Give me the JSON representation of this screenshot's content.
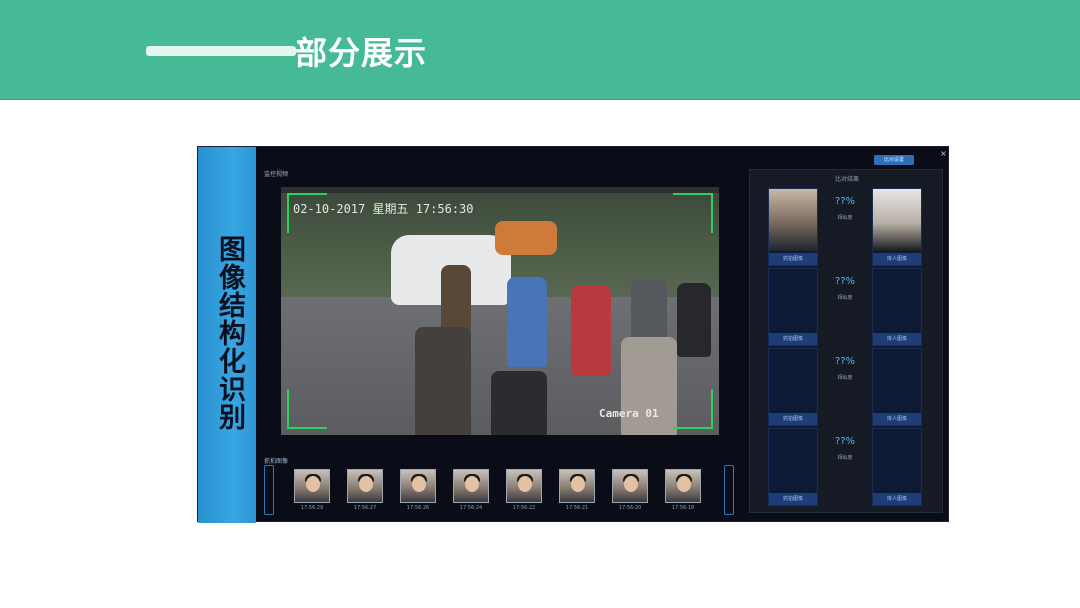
{
  "header": {
    "title": "部分展示"
  },
  "side_band": {
    "text": "图像结构化识别"
  },
  "video_panel": {
    "label": "监控视频",
    "timestamp": "02-10-2017 星期五 17:56:30",
    "camera": "Camera 01"
  },
  "snapshots": {
    "label": "抓拍图像",
    "items": [
      {
        "caption": "17:56:29"
      },
      {
        "caption": "17:56:27"
      },
      {
        "caption": "17:56:26"
      },
      {
        "caption": "17:56:24"
      },
      {
        "caption": "17:56:22"
      },
      {
        "caption": "17:56:21"
      },
      {
        "caption": "17:56:20"
      },
      {
        "caption": "17:56:18"
      }
    ]
  },
  "compare_panel": {
    "title": "比对结果",
    "top_button": "比对设置",
    "close": "×",
    "rows": [
      {
        "left_label": "抓拍图像",
        "pct": "??%",
        "sim_label": "相似度",
        "right_label": "库人图像"
      },
      {
        "left_label": "抓拍图像",
        "pct": "??%",
        "sim_label": "相似度",
        "right_label": "库人图像"
      },
      {
        "left_label": "抓拍图像",
        "pct": "??%",
        "sim_label": "相似度",
        "right_label": "库人图像"
      },
      {
        "left_label": "抓拍图像",
        "pct": "??%",
        "sim_label": "相似度",
        "right_label": "库人图像"
      }
    ]
  },
  "colors": {
    "header": "#46b996",
    "accent_blue": "#36a7e3",
    "frame_green": "#2bd35a",
    "pct": "#4ac0e8"
  }
}
